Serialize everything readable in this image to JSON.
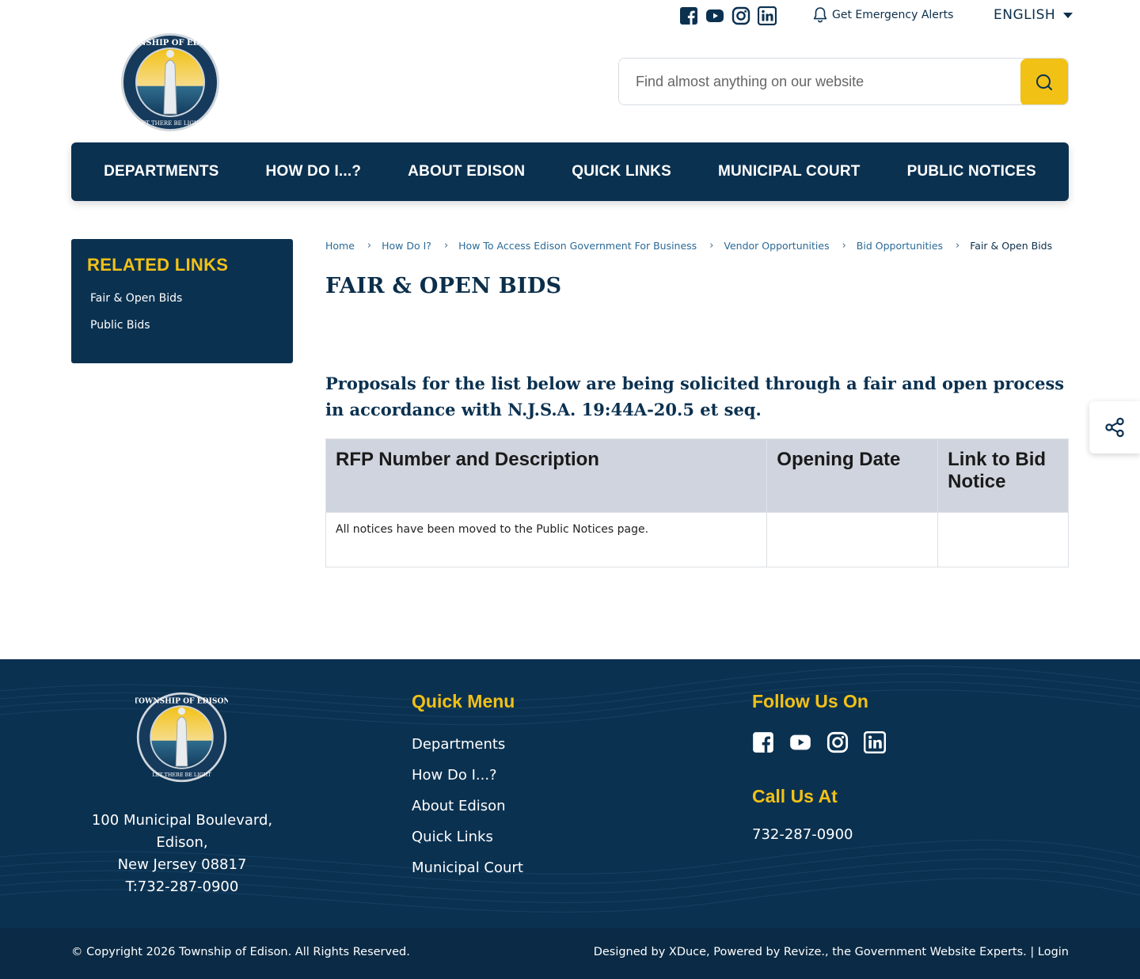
{
  "header": {
    "social": [
      "facebook-icon",
      "youtube-icon",
      "instagram-icon",
      "linkedin-icon"
    ],
    "alerts_label": "Get Emergency Alerts",
    "language": "ENGLISH",
    "search_placeholder": "Find almost anything on our website"
  },
  "nav": {
    "items": [
      "DEPARTMENTS",
      "HOW DO I...?",
      "ABOUT EDISON",
      "QUICK LINKS",
      "MUNICIPAL COURT",
      "PUBLIC NOTICES"
    ]
  },
  "sidebar": {
    "title": "RELATED LINKS",
    "links": [
      "Fair & Open Bids",
      "Public Bids"
    ]
  },
  "breadcrumb": {
    "items": [
      "Home",
      "How Do I?",
      "How To Access Edison Government For Business",
      "Vendor Opportunities",
      "Bid Opportunities",
      "Fair & Open Bids"
    ]
  },
  "page": {
    "title": "FAIR & OPEN BIDS",
    "intro": "Proposals for the list below are being solicited through a fair and open process in accordance with N.J.S.A. 19:44A-20.5 et seq."
  },
  "table": {
    "headers": [
      "RFP Number and Description",
      "Opening Date",
      "Link to Bid Notice"
    ],
    "rows": [
      [
        "All notices have been moved to the Public Notices page.",
        "",
        ""
      ]
    ]
  },
  "footer": {
    "address": [
      "100 Municipal Boulevard,",
      "Edison,",
      "New Jersey 08817",
      "T:732-287-0900"
    ],
    "quick_menu_title": "Quick Menu",
    "quick_menu": [
      "Departments",
      "How Do I...?",
      "About Edison",
      "Quick Links",
      "Municipal Court"
    ],
    "follow_title": "Follow Us On",
    "call_title": "Call Us At",
    "phone": "732-287-0900",
    "copyright": "© Copyright 2026 Township of Edison. All Rights Reserved.",
    "credits": "Designed by XDuce, Powered by Revize., the Government Website Experts. | Login"
  },
  "colors": {
    "navy": "#0b3150",
    "gold": "#f2c116",
    "link": "#2a6a96",
    "table_header": "#cfd4de"
  }
}
